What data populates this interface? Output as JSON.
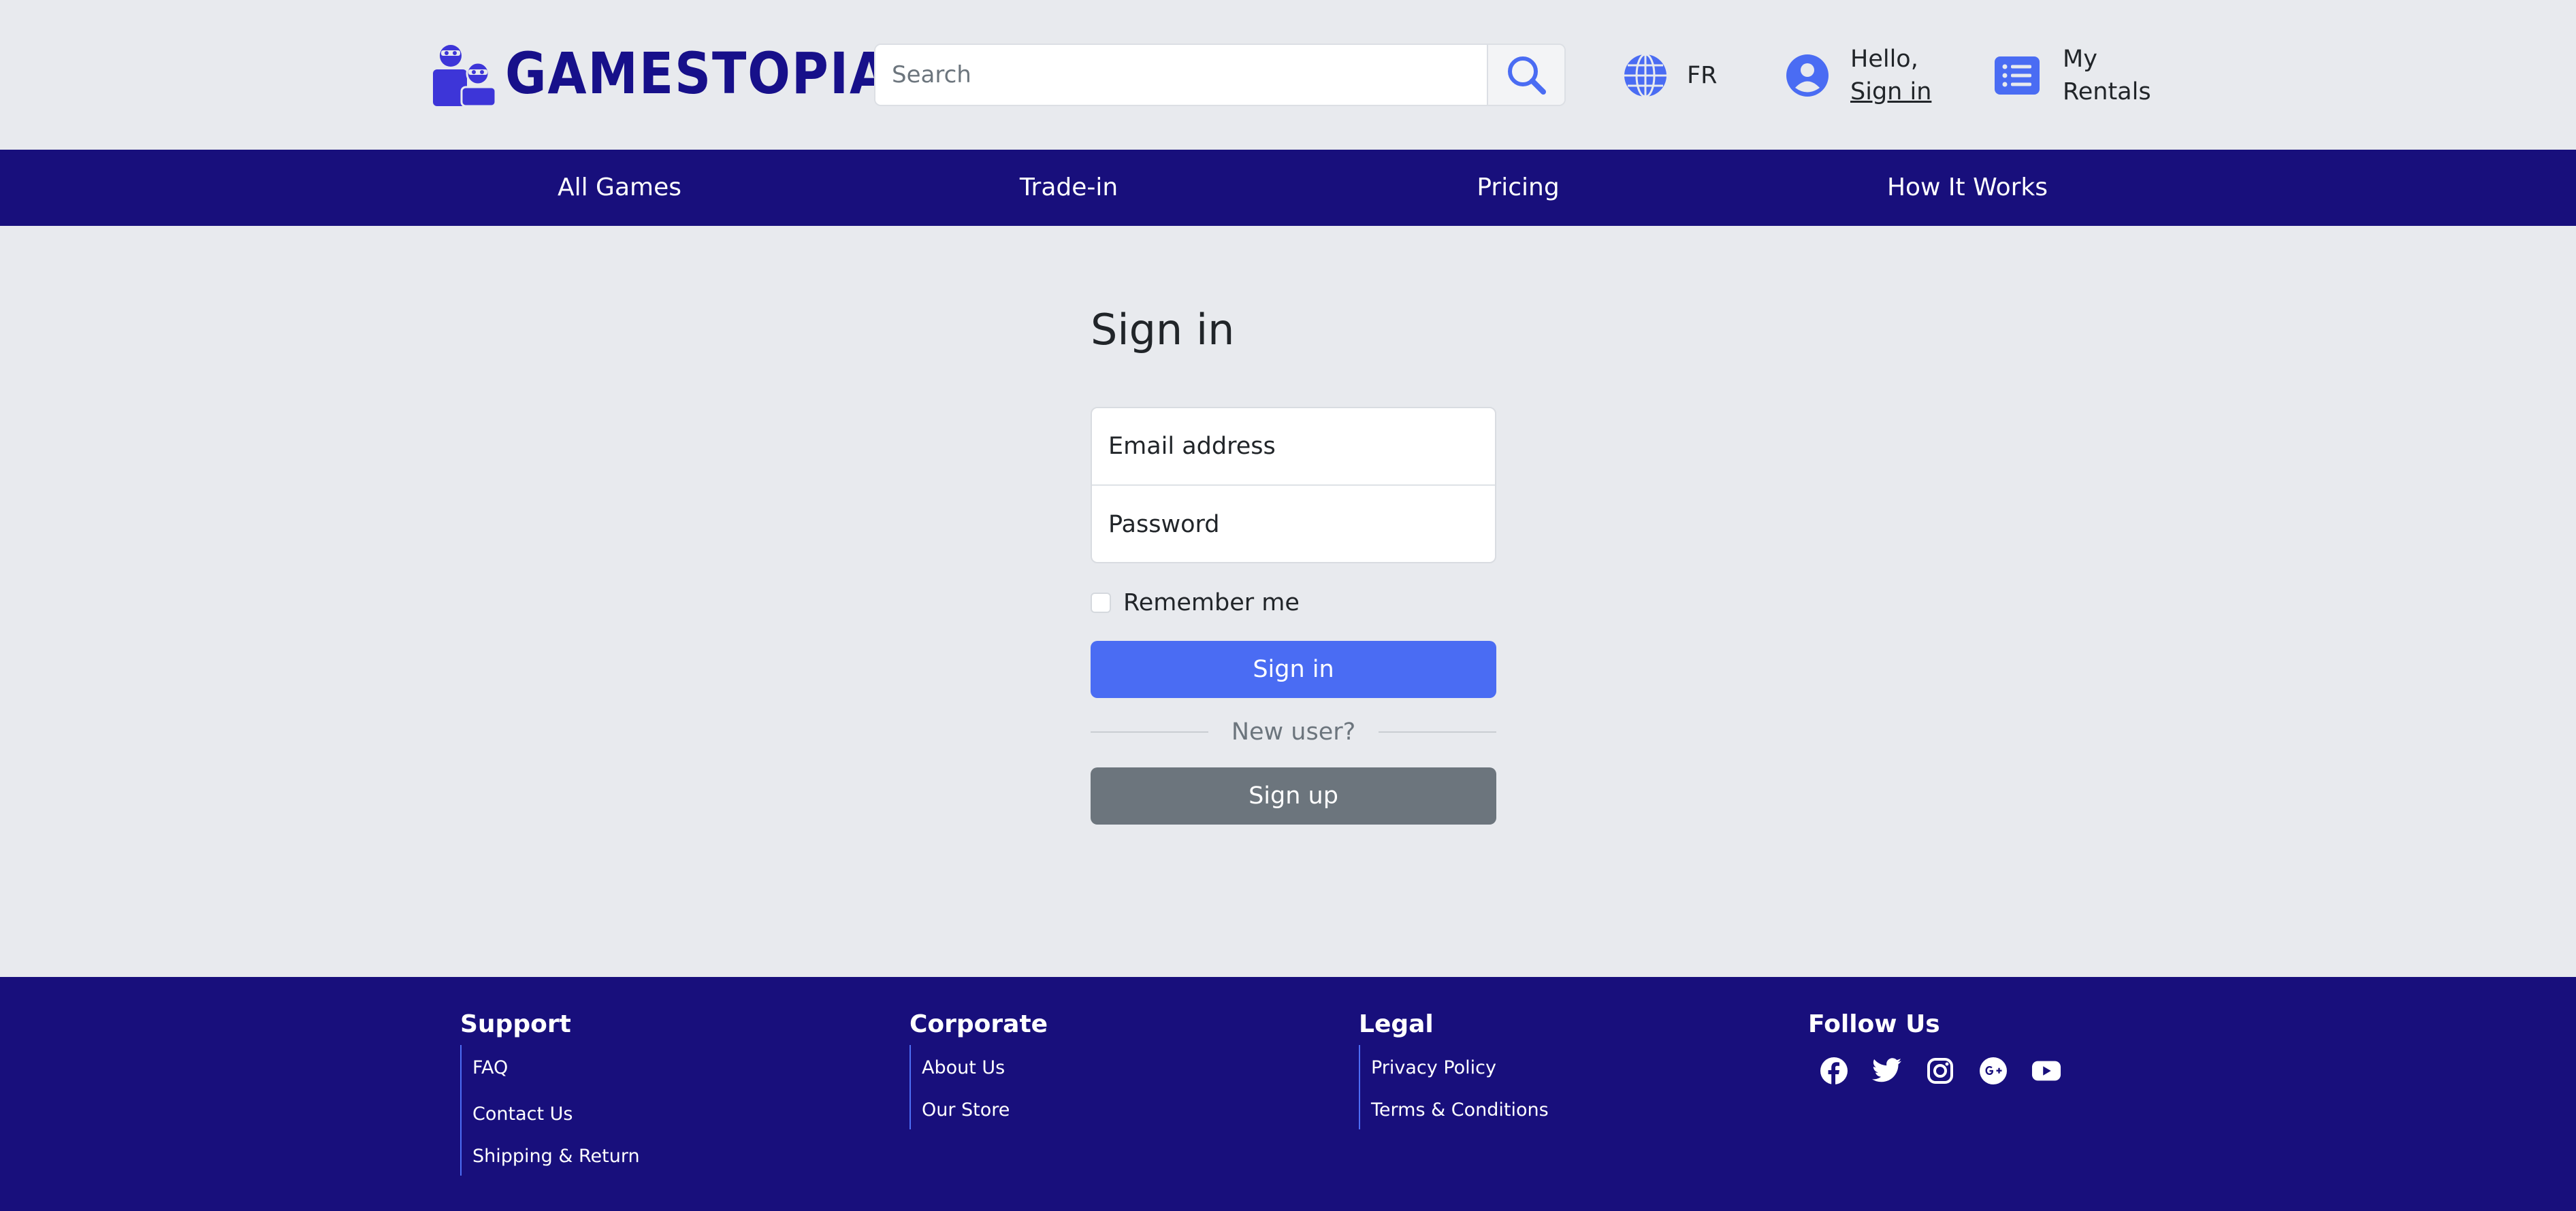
{
  "brand": {
    "name": "GAMESTOPIA"
  },
  "header": {
    "search": {
      "placeholder": "Search"
    },
    "language": {
      "label": "FR"
    },
    "account": {
      "greeting": "Hello,",
      "link": "Sign in"
    },
    "rentals": {
      "line1": "My",
      "line2": "Rentals"
    }
  },
  "nav": {
    "items": [
      {
        "label": "All Games"
      },
      {
        "label": "Trade-in"
      },
      {
        "label": "Pricing"
      },
      {
        "label": "How It Works"
      }
    ]
  },
  "signin": {
    "title": "Sign in",
    "email_placeholder": "Email address",
    "password_placeholder": "Password",
    "remember_label": "Remember me",
    "submit_label": "Sign in",
    "divider_text": "New user?",
    "signup_label": "Sign up"
  },
  "footer": {
    "support": {
      "heading": "Support",
      "links": [
        "FAQ",
        "Contact Us",
        "Shipping & Return"
      ]
    },
    "corporate": {
      "heading": "Corporate",
      "links": [
        "About Us",
        "Our Store"
      ]
    },
    "legal": {
      "heading": "Legal",
      "links": [
        "Privacy Policy",
        "Terms & Conditions"
      ]
    },
    "follow": {
      "heading": "Follow Us",
      "icons": [
        "facebook-icon",
        "twitter-icon",
        "instagram-icon",
        "google-plus-icon",
        "youtube-icon"
      ]
    }
  },
  "colors": {
    "brand_navy": "#180f7c",
    "accent_blue": "#4a6cf3",
    "icon_blue": "#4a6cf3",
    "signup_gray": "#6c757d",
    "page_bg": "#e8eaee"
  }
}
